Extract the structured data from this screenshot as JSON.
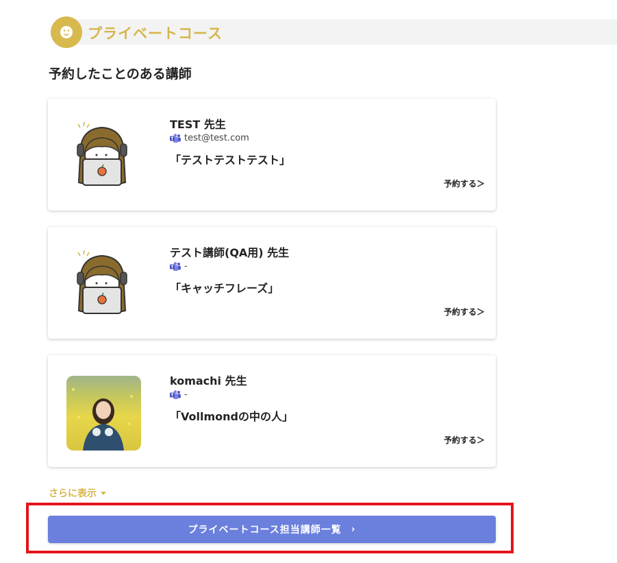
{
  "header": {
    "title": "プライベートコース",
    "icon": "smile-icon",
    "accent": "#d6b64a"
  },
  "section_title": "予約したことのある講師",
  "teachers": [
    {
      "name": "TEST 先生",
      "contact": "test@test.com",
      "catch": "「テストテストテスト」",
      "reserve_label": "予約する＞",
      "avatar": "illustrated-avatar"
    },
    {
      "name": "テスト講師(QA用) 先生",
      "contact": "-",
      "catch": "「キャッチフレーズ」",
      "reserve_label": "予約する＞",
      "avatar": "illustrated-avatar"
    },
    {
      "name": "komachi 先生",
      "contact": "-",
      "catch": "「Vollmondの中の人」",
      "reserve_label": "予約する＞",
      "avatar": "photo-avatar"
    }
  ],
  "more_label": "さらに表示",
  "main_button": {
    "label": "プライベートコース担当講師一覧",
    "chevron": "›",
    "color": "#6b7fdc"
  },
  "highlight_color": "#e3141b"
}
